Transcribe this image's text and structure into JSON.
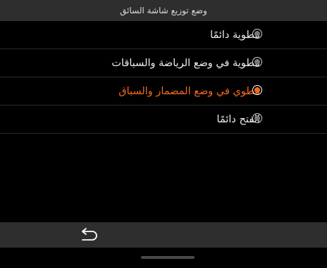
{
  "header": {
    "title": "وضع توزيع شاشة السائق"
  },
  "options": [
    {
      "label": "مطوية دائمًا",
      "selected": false
    },
    {
      "label": "مطوية في وضع الرياضة والسباقات",
      "selected": false
    },
    {
      "label": "مطوي في وضع المضمار والسباق",
      "selected": true
    },
    {
      "label": "الفتح دائمًا",
      "selected": false
    }
  ],
  "colors": {
    "accent": "#f06a1f",
    "header_bg": "#2e2e2e",
    "background": "#000000",
    "text": "#ececec"
  },
  "bottom_bar": {
    "back_icon": "back-arrow-icon"
  }
}
